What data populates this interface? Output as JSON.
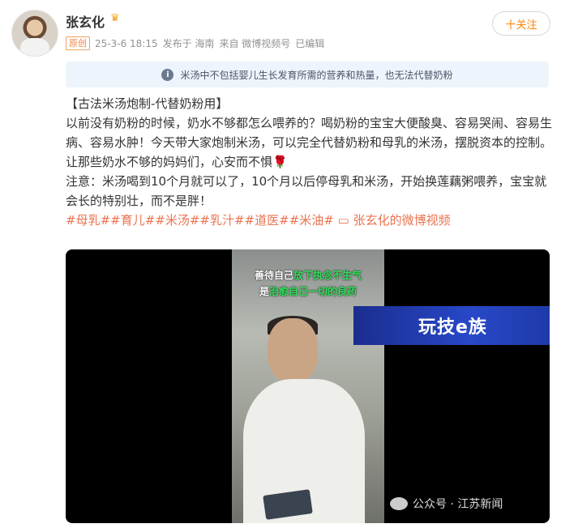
{
  "user": {
    "name": "张玄化",
    "crown_icon": "crown-icon"
  },
  "meta": {
    "badge": "原创",
    "date": "25-3-6 18:15",
    "published": "发布于 海南",
    "source": "来自 微博视频号",
    "edited": "已编辑"
  },
  "follow_label": "十关注",
  "notice": "米汤中不包括婴儿生长发育所需的营养和热量，也无法代替奶粉",
  "post": {
    "title": "【古法米汤炮制-代替奶粉用】",
    "body": "以前没有奶粉的时候，奶水不够都怎么喂养的？喝奶粉的宝宝大便酸臭、容易哭闹、容易生病、容易水肿！今天带大家炮制米汤，可以完全代替奶粉和母乳的米汤，摆脱资本的控制。让那些奶水不够的妈妈们，心安而不惧🌹",
    "note": "注意：米汤喝到10个月就可以了，10个月以后停母乳和米汤，开始换莲藕粥喂养，宝宝就会长的特别壮，而不是胖！",
    "tags": "#母乳##育儿##米汤##乳汁##道医##米油#",
    "video_link": "张玄化的微博视频"
  },
  "video": {
    "caption_1a": "善待自己",
    "caption_1b": "放下执念不生气",
    "caption_2a": "是",
    "caption_2b": "治愈自己一切的良药",
    "brand": "玩技e族",
    "watermark": "公众号 · 江苏新闻"
  }
}
